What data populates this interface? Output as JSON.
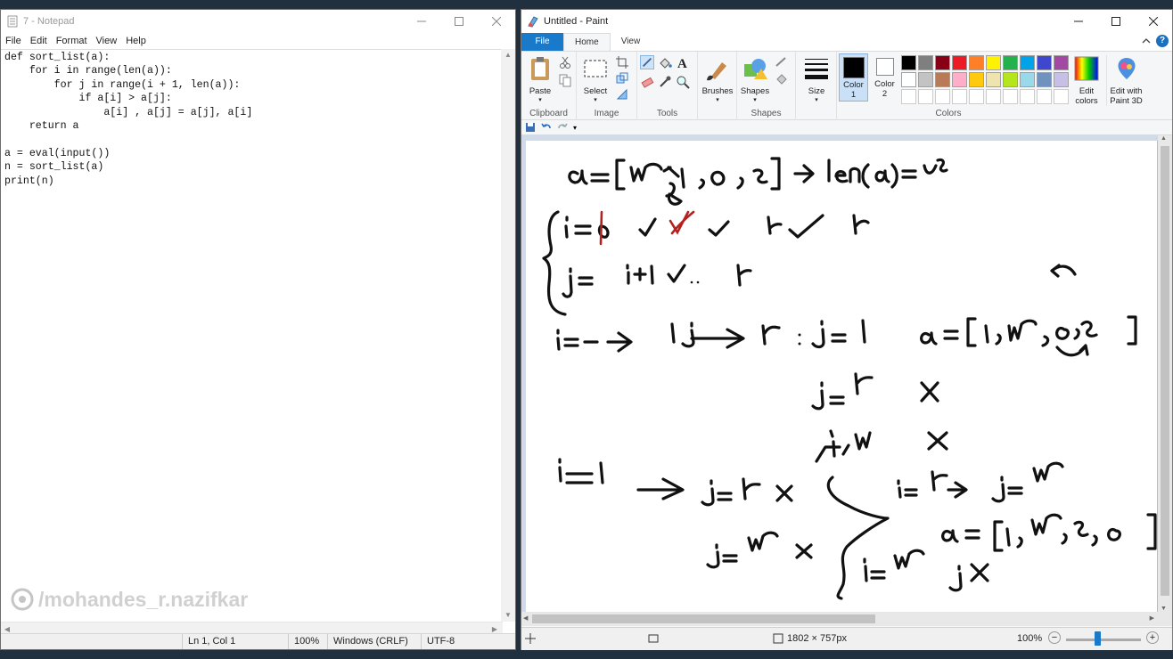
{
  "notepad": {
    "title": "7 - Notepad",
    "menu": [
      "File",
      "Edit",
      "Format",
      "View",
      "Help"
    ],
    "code": "def sort_list(a):\n    for i in range(len(a)):\n        for j in range(i + 1, len(a)):\n            if a[i] > a[j]:\n                a[i] , a[j] = a[j], a[i]\n    return a\n\na = eval(input())\nn = sort_list(a)\nprint(n)",
    "status": {
      "position": "Ln 1, Col 1",
      "zoom": "100%",
      "line_ending": "Windows (CRLF)",
      "encoding": "UTF-8"
    },
    "watermark": "/mohandes_r.nazifkar"
  },
  "paint": {
    "title": "Untitled - Paint",
    "tabs": {
      "file": "File",
      "home": "Home",
      "view": "View"
    },
    "groups": {
      "clipboard": "Clipboard",
      "image": "Image",
      "tools": "Tools",
      "shapes": "Shapes",
      "colors": "Colors"
    },
    "buttons": {
      "paste": "Paste",
      "select": "Select",
      "brushes": "Brushes",
      "shapes": "Shapes",
      "size": "Size",
      "color1_line1": "Color",
      "color1_line2": "1",
      "color2_line1": "Color",
      "color2_line2": "2",
      "edit_colors_line1": "Edit",
      "edit_colors_line2": "colors",
      "paint3d_line1": "Edit with",
      "paint3d_line2": "Paint 3D"
    },
    "palette_row1": [
      "#000000",
      "#7f7f7f",
      "#880015",
      "#ed1c24",
      "#ff7f27",
      "#fff200",
      "#22b14c",
      "#00a2e8",
      "#3f48cc",
      "#a349a4"
    ],
    "palette_row2": [
      "#ffffff",
      "#c3c3c3",
      "#b97a57",
      "#ffaec9",
      "#ffc90e",
      "#efe4b0",
      "#b5e61d",
      "#99d9ea",
      "#7092be",
      "#c8bfe7"
    ],
    "status": {
      "canvas_size": "1802 × 757px",
      "zoom": "100%"
    }
  }
}
